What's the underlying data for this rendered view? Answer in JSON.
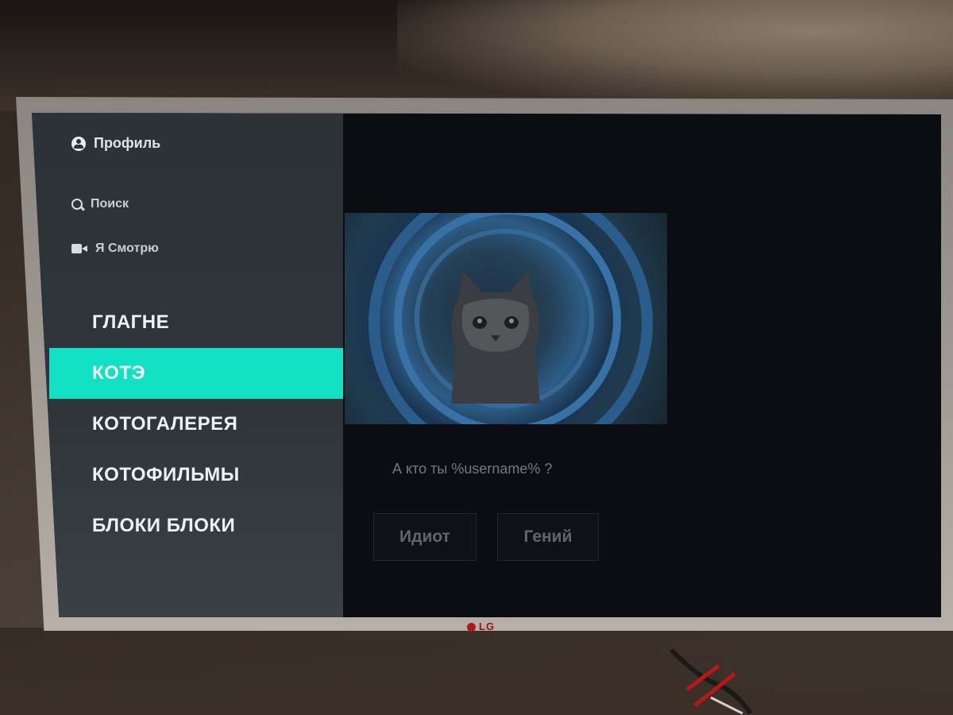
{
  "sidebar": {
    "profile_label": "Профиль",
    "search_label": "Поиск",
    "watching_label": "Я Смотрю",
    "menu": [
      {
        "label": "ГЛАГНЕ",
        "active": false
      },
      {
        "label": "КОТЭ",
        "active": true
      },
      {
        "label": "КОТОГАЛЕРЕЯ",
        "active": false
      },
      {
        "label": "КОТОФИЛЬМЫ",
        "active": false
      },
      {
        "label": "БЛОКИ БЛОКИ",
        "active": false
      }
    ]
  },
  "content": {
    "question": "А кто ты %username% ?",
    "answers": {
      "idiot": "Идиот",
      "genius": "Гений"
    }
  },
  "tv": {
    "brand": "LG"
  },
  "colors": {
    "accent": "#12e0c2",
    "sidebar_bg": "#2e353b",
    "screen_bg": "#0b0d12"
  },
  "icons": [
    "profile-icon",
    "search-icon",
    "camera-icon"
  ]
}
